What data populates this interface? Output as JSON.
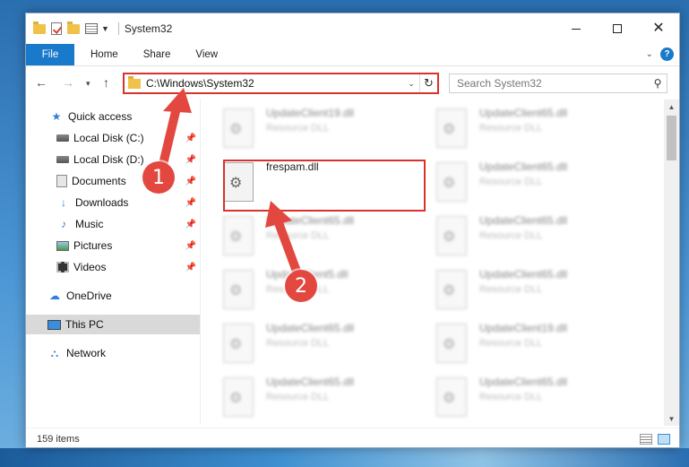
{
  "window": {
    "title": "System32",
    "tabs": [
      "File",
      "Home",
      "Share",
      "View"
    ]
  },
  "address_bar": {
    "path": "C:\\Windows\\System32"
  },
  "search": {
    "placeholder": "Search System32"
  },
  "nav_pane": {
    "items": [
      {
        "label": "Quick access",
        "icon": "star-icon",
        "pinned": false
      },
      {
        "label": "Local Disk (C:)",
        "icon": "drive-icon",
        "pinned": true
      },
      {
        "label": "Local Disk (D:)",
        "icon": "drive-icon",
        "pinned": true
      },
      {
        "label": "Documents",
        "icon": "documents-icon",
        "pinned": true
      },
      {
        "label": "Downloads",
        "icon": "download-icon",
        "pinned": true
      },
      {
        "label": "Music",
        "icon": "music-icon",
        "pinned": true
      },
      {
        "label": "Pictures",
        "icon": "pictures-icon",
        "pinned": true
      },
      {
        "label": "Videos",
        "icon": "videos-icon",
        "pinned": true
      },
      {
        "label": "OneDrive",
        "icon": "cloud-icon",
        "pinned": false
      },
      {
        "label": "This PC",
        "icon": "computer-icon",
        "pinned": false,
        "selected": true
      },
      {
        "label": "Network",
        "icon": "network-icon",
        "pinned": false
      }
    ]
  },
  "files": [
    {
      "name": "UpdateClient19.dll",
      "type": "Resource DLL",
      "blurred": true
    },
    {
      "name": "UpdateClient65.dll",
      "type": "Resource DLL",
      "blurred": true
    },
    {
      "name": "frespam.dll",
      "type": "",
      "blurred": false,
      "highlighted": true
    },
    {
      "name": "UpdateClient65.dll",
      "type": "Resource DLL",
      "blurred": true
    },
    {
      "name": "UpdateClient65.dll",
      "type": "Resource DLL",
      "blurred": true
    },
    {
      "name": "UpdateClient65.dll",
      "type": "Resource DLL",
      "blurred": true
    },
    {
      "name": "UpdateClient5.dll",
      "type": "Resource DLL",
      "blurred": true
    },
    {
      "name": "UpdateClient65.dll",
      "type": "Resource DLL",
      "blurred": true
    },
    {
      "name": "UpdateClient65.dll",
      "type": "Resource DLL",
      "blurred": true
    },
    {
      "name": "UpdateClient19.dll",
      "type": "Resource DLL",
      "blurred": true
    },
    {
      "name": "UpdateClient65.dll",
      "type": "Resource DLL",
      "blurred": true
    },
    {
      "name": "UpdateClient65.dll",
      "type": "Resource DLL",
      "blurred": true
    }
  ],
  "status": {
    "item_count": "159 items"
  },
  "annotations": {
    "step1": "1",
    "step2": "2",
    "highlight_color": "#d8322d"
  }
}
